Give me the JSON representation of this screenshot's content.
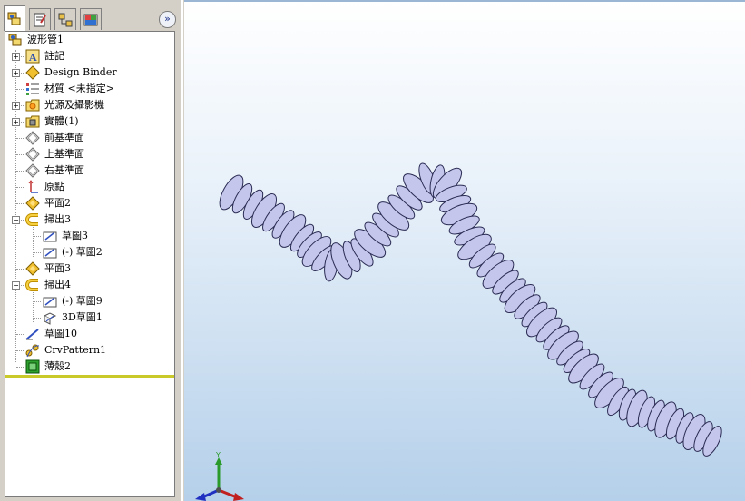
{
  "tabs": [
    {
      "name": "featuremanager",
      "icon": "feature-tree-icon"
    },
    {
      "name": "propertymanager",
      "icon": "property-icon"
    },
    {
      "name": "configurationmanager",
      "icon": "configuration-icon"
    },
    {
      "name": "displaymanager",
      "icon": "display-icon"
    }
  ],
  "expand_label": "»",
  "tree": {
    "root": "波形管1",
    "items": [
      {
        "label": "註記",
        "icon": "annotations-icon",
        "expander": "+"
      },
      {
        "label": "Design Binder",
        "icon": "design-binder-icon",
        "expander": "+"
      },
      {
        "label": "材質 <未指定>",
        "icon": "material-icon",
        "expander": ""
      },
      {
        "label": "光源及攝影機",
        "icon": "lights-camera-icon",
        "expander": "+"
      },
      {
        "label": "實體(1)",
        "icon": "solid-bodies-icon",
        "expander": "+"
      },
      {
        "label": "前基準面",
        "icon": "plane-icon",
        "expander": ""
      },
      {
        "label": "上基準面",
        "icon": "plane-icon",
        "expander": ""
      },
      {
        "label": "右基準面",
        "icon": "plane-icon",
        "expander": ""
      },
      {
        "label": "原點",
        "icon": "origin-icon",
        "expander": ""
      },
      {
        "label": "平面2",
        "icon": "plane-feature-icon",
        "expander": ""
      },
      {
        "label": "掃出3",
        "icon": "sweep-icon",
        "expander": "−"
      },
      {
        "label": "草圖3",
        "icon": "sketch-icon",
        "expander": ""
      },
      {
        "label": "(-) 草圖2",
        "icon": "sketch-icon",
        "expander": ""
      },
      {
        "label": "平面3",
        "icon": "plane-feature-icon",
        "expander": ""
      },
      {
        "label": "掃出4",
        "icon": "sweep-icon",
        "expander": "−"
      },
      {
        "label": "(-) 草圖9",
        "icon": "sketch-icon",
        "expander": ""
      },
      {
        "label": "3D草圖1",
        "icon": "3d-sketch-icon",
        "expander": ""
      },
      {
        "label": "草圖10",
        "icon": "sketch-icon",
        "expander": ""
      },
      {
        "label": "CrvPattern1",
        "icon": "curve-pattern-icon",
        "expander": ""
      },
      {
        "label": "薄殼2",
        "icon": "shell-icon",
        "expander": ""
      }
    ]
  },
  "triad": {
    "y_label": "Y"
  },
  "colors": {
    "tube_fill": "#c4c6ec",
    "tube_stroke": "#2a2a52",
    "viewport_top": "#ffffff",
    "viewport_bottom": "#b5d0ea"
  }
}
